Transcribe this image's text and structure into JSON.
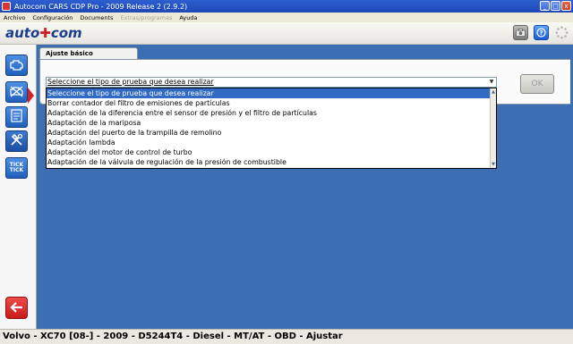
{
  "window": {
    "title": "Autocom CARS CDP Pro - 2009 Release 2 (2.9.2)",
    "buttons": [
      "_",
      "□",
      "x"
    ]
  },
  "menu": {
    "items": [
      {
        "label": "Archivo",
        "enabled": true
      },
      {
        "label": "Configuración",
        "enabled": true
      },
      {
        "label": "Documents",
        "enabled": true
      },
      {
        "label": "Extras/programas",
        "enabled": false
      },
      {
        "label": "Ayuda",
        "enabled": true
      }
    ]
  },
  "toolbar": {
    "logo_left": "auto",
    "logo_sep": "✚",
    "logo_right": "com",
    "icons": [
      "camera-icon",
      "help-icon",
      "spinner-icon"
    ]
  },
  "sidebar": {
    "items": [
      {
        "icon": "engine-icon"
      },
      {
        "icon": "eobd-icon"
      },
      {
        "icon": "report-icon"
      },
      {
        "icon": "tools-icon",
        "active": true
      },
      {
        "icon": "tick-tick-icon",
        "text1": "TICK",
        "text2": "TICK"
      }
    ],
    "back_icon": "back-arrow-icon"
  },
  "panel": {
    "tab_label": "Ajuste básico",
    "select_value": "Seleccione el tipo de prueba que desea realizar",
    "options": [
      "Seleccione el tipo de prueba que desea realizar",
      "Borrar contador del filtro de emisiones de partículas",
      "Adaptación de la diferencia entre el sensor de presión y el filtro de partículas",
      "Adaptación de la mariposa",
      "Adaptación del puerto de la trampilla de remolino",
      "Adaptación lambda",
      "Adaptación del motor de control de turbo",
      "Adaptación de la válvula de regulación de la presión de combustible"
    ],
    "highlighted_index": 0,
    "ok_label": "OK"
  },
  "status": {
    "text": "Volvo - XC70 [08-] - 2009 - D5244T4 - Diesel - MT/AT - OBD - Ajustar"
  },
  "colors": {
    "background": "#3c6fb1",
    "highlight": "#316ac5",
    "accent_red": "#d2232a"
  }
}
